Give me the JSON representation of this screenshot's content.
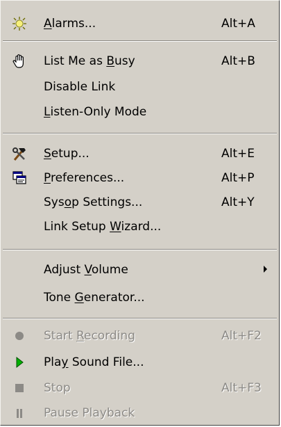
{
  "menu": {
    "alarms": {
      "pre": "",
      "mn": "A",
      "post": "larms...",
      "accel": "Alt+A",
      "icon": "sun-alarm-icon"
    },
    "busy": {
      "pre": "List Me as ",
      "mn": "B",
      "post": "usy",
      "accel": "Alt+B",
      "icon": "hand-icon"
    },
    "disable_link": {
      "label": "Disable Link"
    },
    "listen_only": {
      "pre": "",
      "mn": "L",
      "post": "isten-Only Mode"
    },
    "setup": {
      "pre": "",
      "mn": "S",
      "post": "etup...",
      "accel": "Alt+E",
      "icon": "tools-icon"
    },
    "preferences": {
      "pre": "",
      "mn": "P",
      "post": "references...",
      "accel": "Alt+P",
      "icon": "windows-icon"
    },
    "sysop": {
      "pre": "Sys",
      "mn": "o",
      "post": "p Settings...",
      "accel": "Alt+Y"
    },
    "wizard": {
      "pre": "Link Setup ",
      "mn": "W",
      "post": "izard..."
    },
    "volume": {
      "pre": "Adjust ",
      "mn": "V",
      "post": "olume",
      "icon": "submenu-arrow-icon"
    },
    "tone": {
      "pre": "Tone ",
      "mn": "G",
      "post": "enerator..."
    },
    "record": {
      "pre": "Start ",
      "mn": "R",
      "post": "ecording",
      "accel": "Alt+F2",
      "icon": "record-icon"
    },
    "play": {
      "pre": "Pla",
      "mn": "y",
      "post": " Sound File...",
      "icon": "play-icon"
    },
    "stop": {
      "label": "Stop",
      "accel": "Alt+F3",
      "icon": "stop-icon"
    },
    "pause": {
      "label": "Pause Playback",
      "icon": "pause-icon"
    }
  },
  "colors": {
    "menu_bg": "#d4d0c8",
    "disabled_text": "#8c8a86",
    "play_green": "#00b000"
  }
}
